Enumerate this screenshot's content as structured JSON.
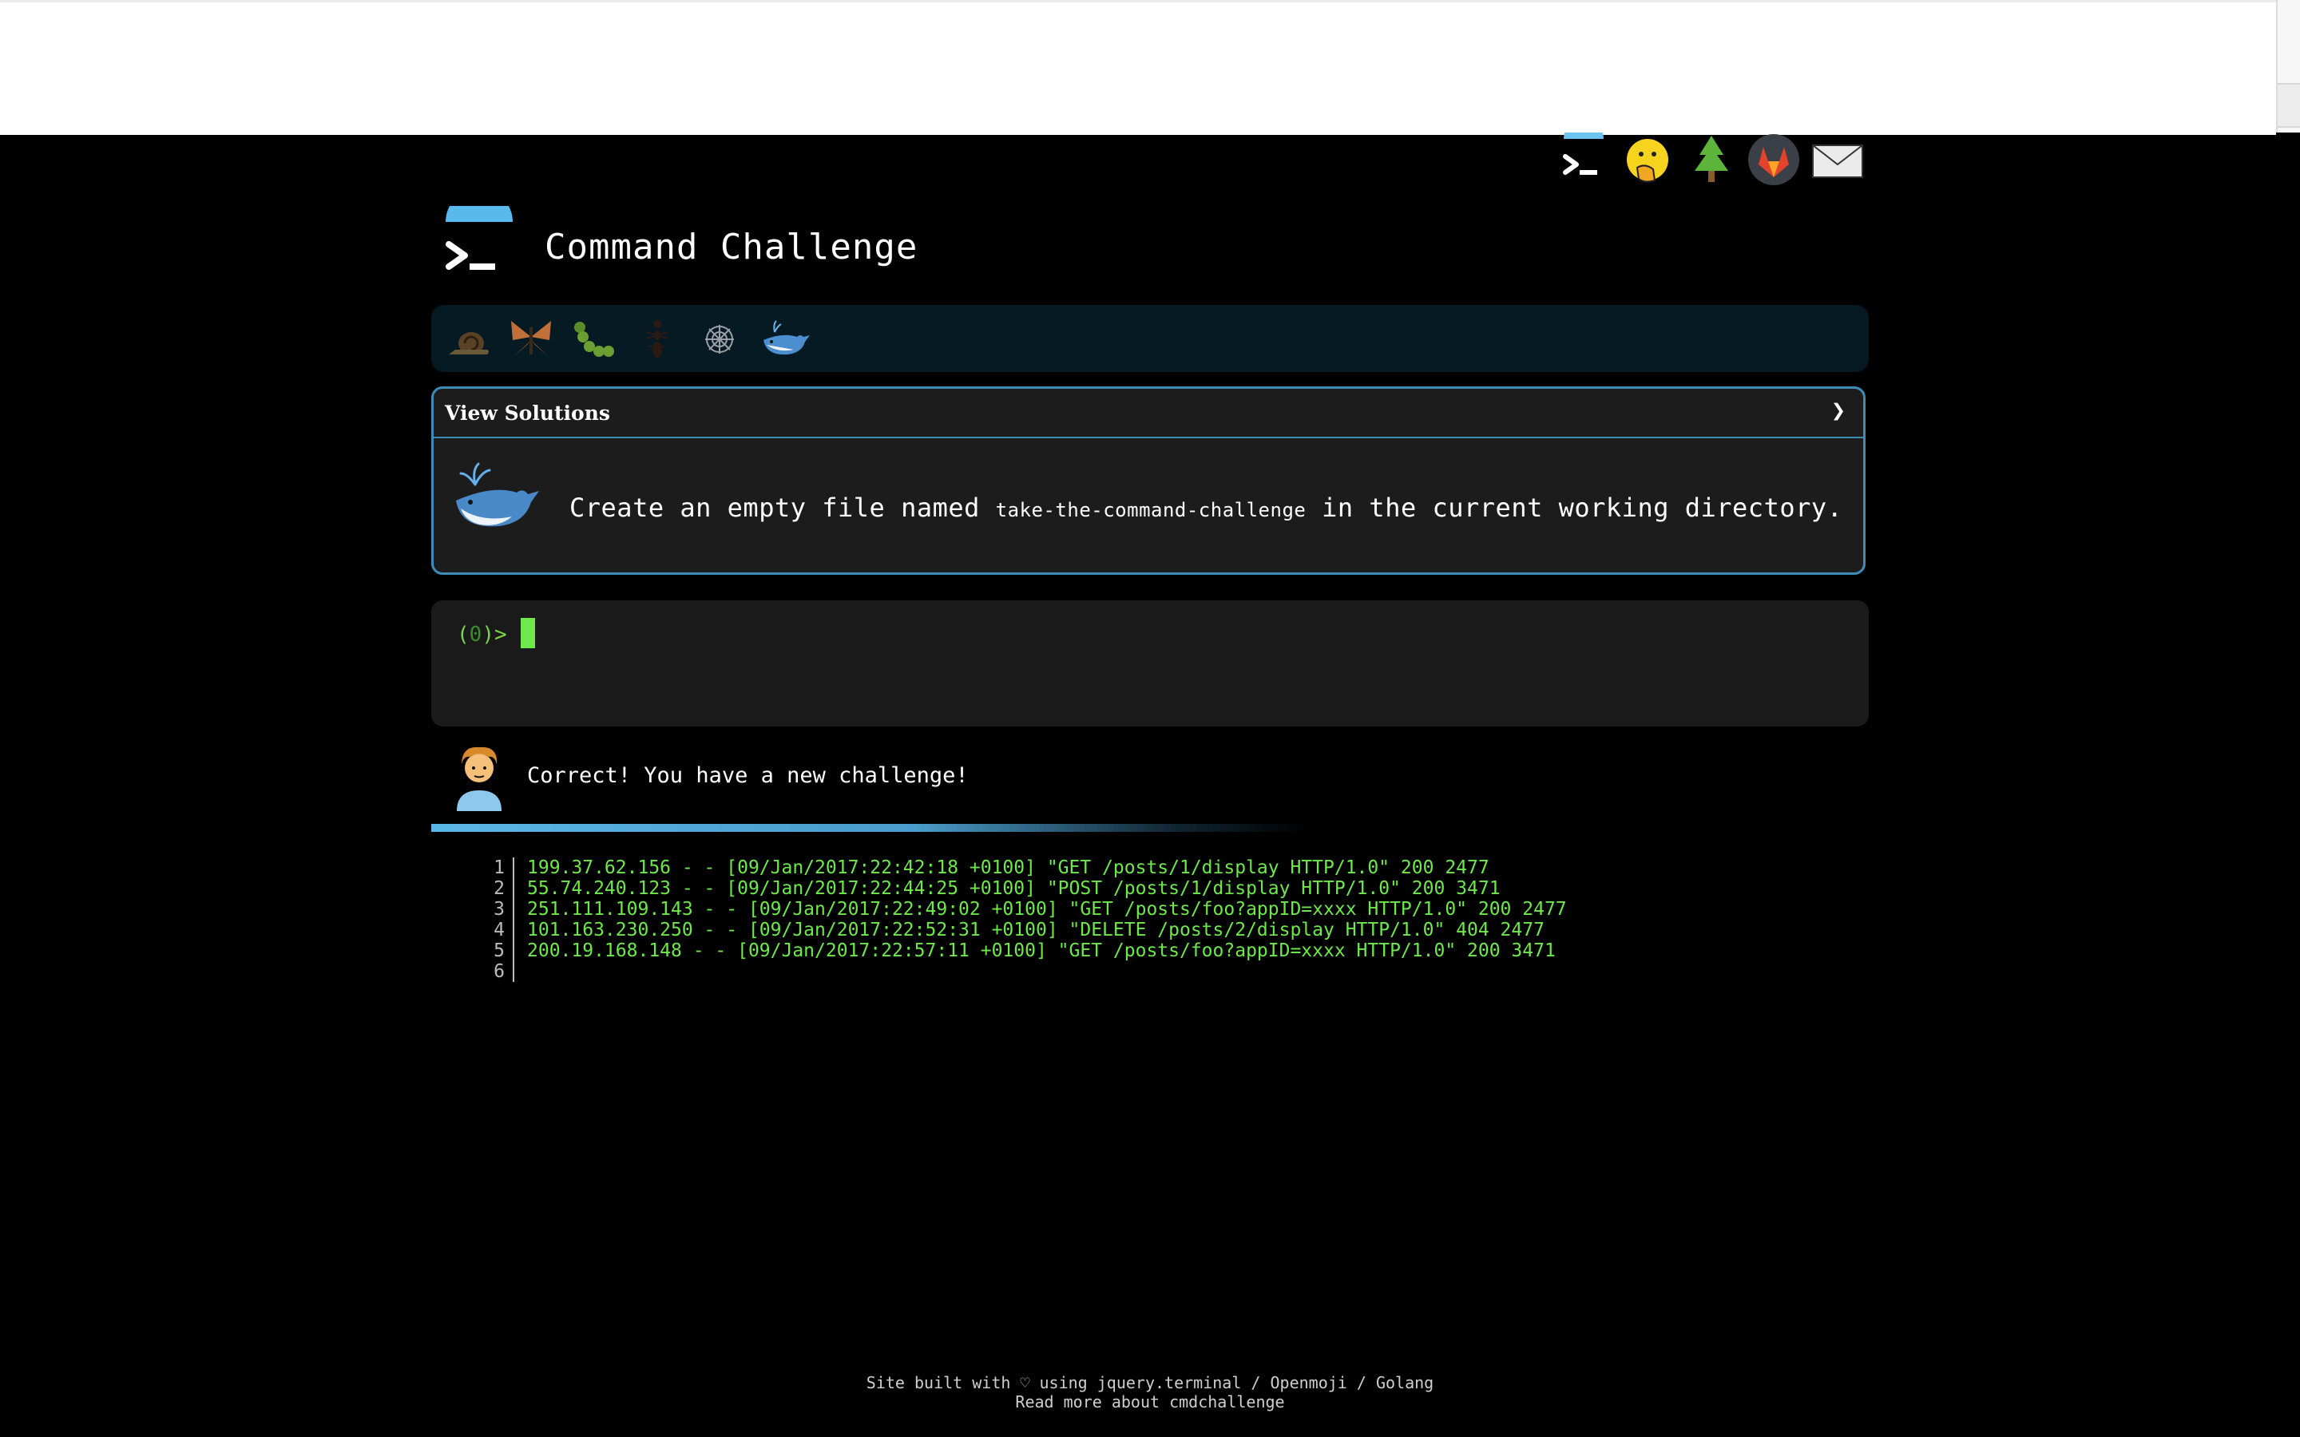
{
  "site": {
    "title": "Command Challenge"
  },
  "top_nav": {
    "icons": [
      "terminal-logo-icon",
      "face-hand-over-mouth-icon",
      "evergreen-tree-icon",
      "gitlab-fox-icon",
      "envelope-icon"
    ]
  },
  "level_bar": {
    "levels": [
      "snail-icon",
      "butterfly-icon",
      "caterpillar-icon",
      "ant-icon",
      "spider-web-icon",
      "whale-icon"
    ]
  },
  "solutions": {
    "header_label": "View Solutions",
    "chevron": "❯"
  },
  "challenge": {
    "icon": "whale-icon",
    "text_before": "Create an empty file named",
    "filename": "take-the-command-challenge",
    "text_after": "in the current working directory."
  },
  "terminal": {
    "prompt_open": "(",
    "prompt_num": "0",
    "prompt_close": ")>",
    "input_value": ""
  },
  "feedback": {
    "avatar": "person-curly-hair-icon",
    "text": "Correct! You have a new challenge!",
    "progress": 0.6
  },
  "output": {
    "lines": [
      {
        "num": "1",
        "text": "199.37.62.156 - - [09/Jan/2017:22:42:18 +0100] \"GET /posts/1/display HTTP/1.0\" 200 2477"
      },
      {
        "num": "2",
        "text": "55.74.240.123 - - [09/Jan/2017:22:44:25 +0100] \"POST /posts/1/display HTTP/1.0\" 200 3471"
      },
      {
        "num": "3",
        "text": "251.111.109.143 - - [09/Jan/2017:22:49:02 +0100] \"GET /posts/foo?appID=xxxx HTTP/1.0\" 200 2477"
      },
      {
        "num": "4",
        "text": "101.163.230.250 - - [09/Jan/2017:22:52:31 +0100] \"DELETE /posts/2/display HTTP/1.0\" 404 2477"
      },
      {
        "num": "5",
        "text": "200.19.168.148 - - [09/Jan/2017:22:57:11 +0100] \"GET /posts/foo?appID=xxxx HTTP/1.0\" 200 3471"
      },
      {
        "num": "6",
        "text": ""
      }
    ]
  },
  "footer": {
    "line1": "Site built with ♡ using jquery.terminal / Openmoji / Golang",
    "line2": "Read more about cmdchallenge"
  },
  "colors": {
    "accent": "#3d8cb8",
    "terminal_green": "#6ee84a",
    "background": "#000000"
  }
}
